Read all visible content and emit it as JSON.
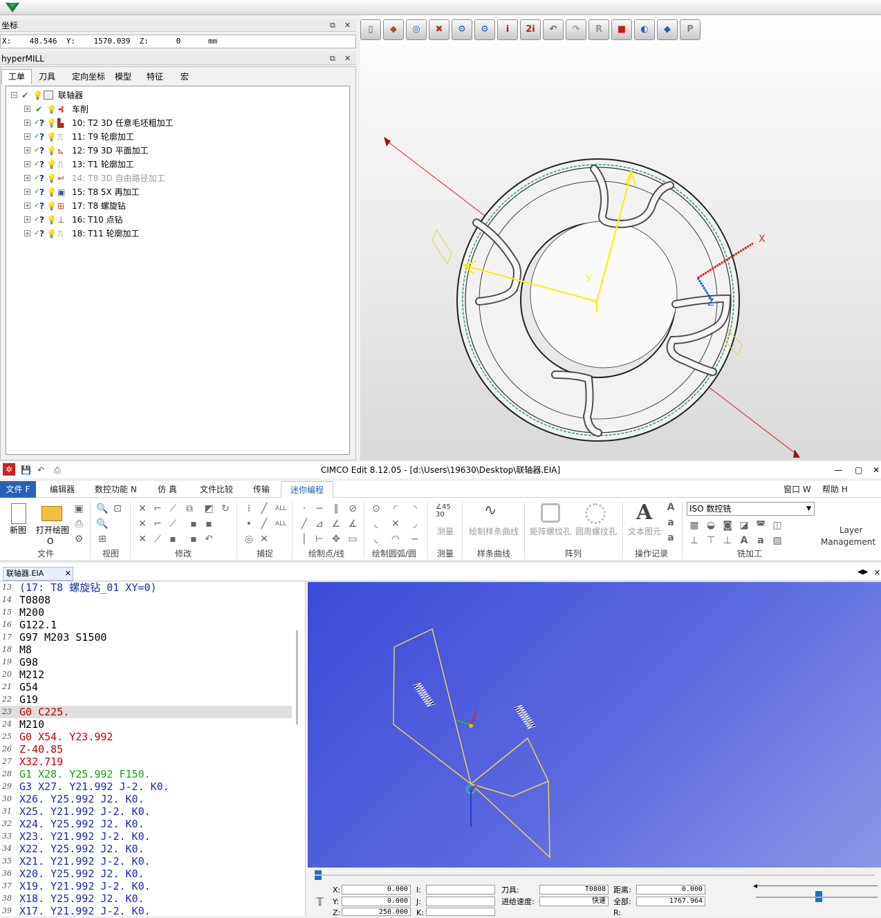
{
  "coord_panel": {
    "title": "坐标",
    "readout": "X:    48.546  Y:    1570.039  Z:      0      mm"
  },
  "hypermill": {
    "title": "hyperMILL",
    "tabs": [
      "工单",
      "刀具",
      "定向坐标",
      "模型",
      "特征",
      "宏"
    ],
    "tree": [
      {
        "label": "联轴器",
        "disabled": false
      },
      {
        "label": "车削",
        "disabled": false
      },
      {
        "label": "10: T2 3D 任意毛坯粗加工",
        "disabled": false
      },
      {
        "label": "11: T9 轮廓加工",
        "disabled": false
      },
      {
        "label": "12: T9 3D 平面加工",
        "disabled": false
      },
      {
        "label": "13: T1 轮廓加工",
        "disabled": false
      },
      {
        "label": "14: T8 3D 自由路径加工",
        "disabled": true
      },
      {
        "label": "15: T8 5X 再加工",
        "disabled": false
      },
      {
        "label": "17: T8 螺旋钻",
        "disabled": false
      },
      {
        "label": "16: T10 点钻",
        "disabled": false
      },
      {
        "label": "18: T11 轮廓加工",
        "disabled": false
      }
    ]
  },
  "view3d": {
    "axis_x": "X",
    "axis_z": "Z",
    "axis_y": "Y"
  },
  "cimco": {
    "title": "CIMCO Edit 8.12.05 - [d:\\Users\\19630\\Desktop\\联轴器.EIA]",
    "menus": [
      "文件 F",
      "编辑器",
      "数控功能 N",
      "仿 真",
      "文件比较",
      "传输",
      "迷你编程"
    ],
    "menu_right": [
      "窗口 W",
      "帮助 H"
    ],
    "ribbon": {
      "new": "新图",
      "open": "打开绘图",
      "open_sub": "O",
      "measure": "测量",
      "spline": "绘制样条曲线",
      "rect_thread": "矩阵螺纹孔",
      "circ_thread": "圆周螺纹孔",
      "text": "文本图元",
      "machine_select": "ISO 数控铣",
      "layer": "Layer",
      "layer2": "Management",
      "groups": [
        "文件",
        "视图",
        "修改",
        "捕捉",
        "绘制点/线",
        "绘制圆弧/圆",
        "测量",
        "样条曲线",
        "阵列",
        "操作记录",
        "铣加工"
      ]
    },
    "file_tab": "联轴器.EIA",
    "lines": [
      {
        "n": "13",
        "t": "(17: T8 螺旋钻_01 XY=0)",
        "c": "#1a2aa8"
      },
      {
        "n": "14",
        "t": "T0808",
        "c": "#000000"
      },
      {
        "n": "15",
        "t": "M200",
        "c": "#000000"
      },
      {
        "n": "16",
        "t": "G122.1",
        "c": "#000000"
      },
      {
        "n": "17",
        "t": "G97 M203 S1500",
        "c": "#000000"
      },
      {
        "n": "18",
        "t": "M8",
        "c": "#000000"
      },
      {
        "n": "19",
        "t": "G98",
        "c": "#000000"
      },
      {
        "n": "20",
        "t": "M212",
        "c": "#000000"
      },
      {
        "n": "21",
        "t": "G54",
        "c": "#000000"
      },
      {
        "n": "22",
        "t": "G19",
        "c": "#000000"
      },
      {
        "n": "23",
        "t": "G0 C225.",
        "c": "#c00000",
        "hl": true
      },
      {
        "n": "24",
        "t": "M210",
        "c": "#000000"
      },
      {
        "n": "25",
        "t": "G0 X54. Y23.992",
        "c": "#c00000"
      },
      {
        "n": "26",
        "t": "Z-40.85",
        "c": "#c00000"
      },
      {
        "n": "27",
        "t": "X32.719",
        "c": "#c00000"
      },
      {
        "n": "28",
        "t": "G1 X28. Y25.992 F150.",
        "c": "#1a9a1a"
      },
      {
        "n": "29",
        "t": "G3 X27. Y21.992 J-2. K0.",
        "c": "#1a2aa8"
      },
      {
        "n": "30",
        "t": "X26. Y25.992 J2. K0.",
        "c": "#1a2aa8"
      },
      {
        "n": "31",
        "t": "X25. Y21.992 J-2. K0.",
        "c": "#1a2aa8"
      },
      {
        "n": "32",
        "t": "X24. Y25.992 J2. K0.",
        "c": "#1a2aa8"
      },
      {
        "n": "33",
        "t": "X23. Y21.992 J-2. K0.",
        "c": "#1a2aa8"
      },
      {
        "n": "34",
        "t": "X22. Y25.992 J2. K0.",
        "c": "#1a2aa8"
      },
      {
        "n": "35",
        "t": "X21. Y21.992 J-2. K0.",
        "c": "#1a2aa8"
      },
      {
        "n": "36",
        "t": "X20. Y25.992 J2. K0.",
        "c": "#1a2aa8"
      },
      {
        "n": "37",
        "t": "X19. Y21.992 J-2. K0.",
        "c": "#1a2aa8"
      },
      {
        "n": "38",
        "t": "X18. Y25.992 J2. K0.",
        "c": "#1a2aa8"
      },
      {
        "n": "39",
        "t": "X17. Y21.992 J-2. K0.",
        "c": "#1a2aa8"
      }
    ],
    "sim": {
      "x_label": "X:",
      "x_val": "0.000",
      "y_label": "Y:",
      "y_val": "0.000",
      "z_label": "Z:",
      "z_val": "250.000",
      "i_label": "I:",
      "j_label": "J:",
      "k_label": "K:",
      "tool_label": "刀具:",
      "tool_val": "T0808",
      "feed_label": "进给速度:",
      "feed_val": "快速",
      "dist_label": "距离:",
      "dist_val": "0.000",
      "total_label": "全部:",
      "total_val": "1767.964",
      "r_label": "R:"
    }
  }
}
